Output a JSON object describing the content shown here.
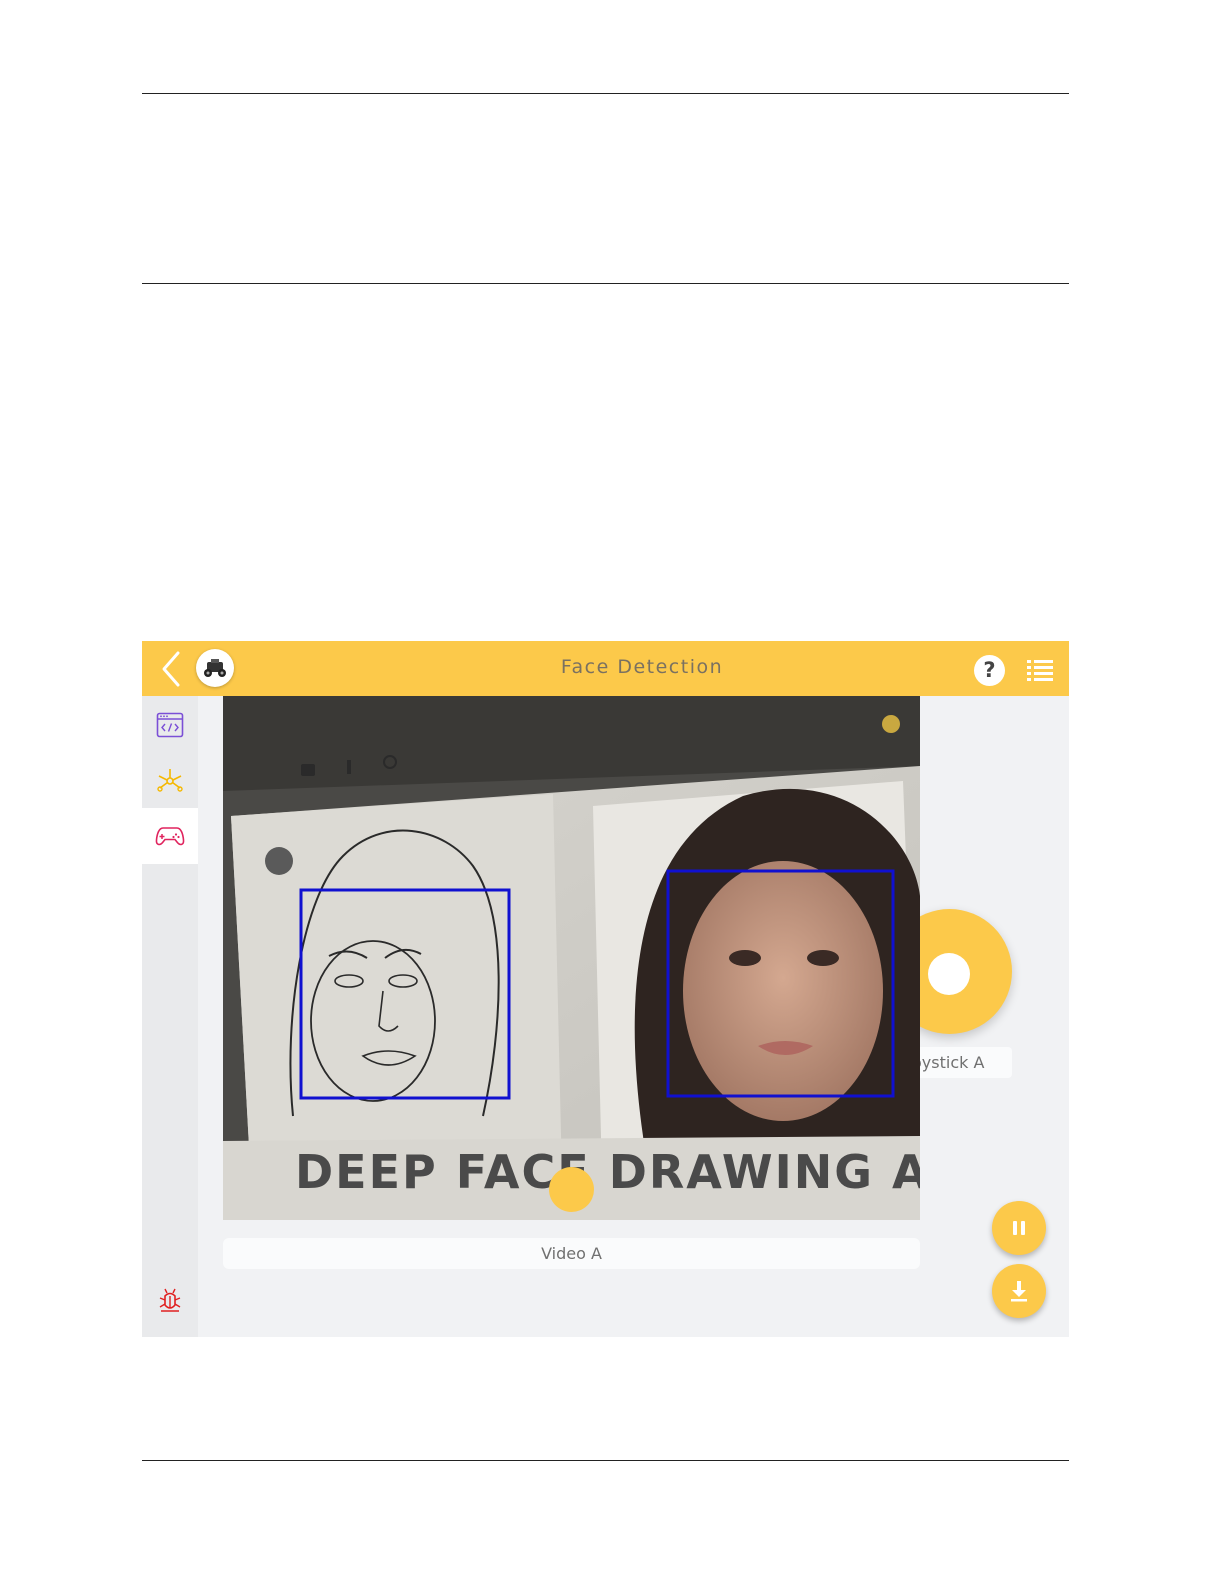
{
  "header": {
    "title": "Face Detection",
    "back_icon": "chevron-left-icon",
    "help_label": "?",
    "menu_icon": "list-icon"
  },
  "sidebar": {
    "items": [
      {
        "name": "code",
        "icon": "code-window-icon"
      },
      {
        "name": "nodes",
        "icon": "nodes-icon"
      },
      {
        "name": "controller",
        "icon": "gamepad-icon",
        "active": true
      },
      {
        "name": "debug",
        "icon": "bug-icon"
      }
    ]
  },
  "video_widget": {
    "label": "Video A",
    "banner_text": "DEEP FACE DRAWING A",
    "detections": 2
  },
  "joystick_widget": {
    "label": "oystick A"
  },
  "buttons": {
    "pause_icon": "pause-icon",
    "download_icon": "download-icon"
  },
  "colors": {
    "accent": "#fcc94a",
    "detection_box": "#1010d0",
    "code_icon": "#7b4fd6",
    "nodes_icon": "#f5b800",
    "controller_icon": "#e0245e",
    "debug_icon": "#e02020"
  }
}
